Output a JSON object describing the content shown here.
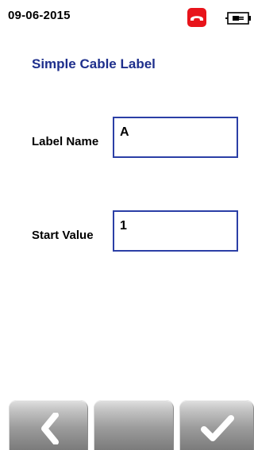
{
  "status": {
    "date": "09-06-2015"
  },
  "icons": {
    "phone": "phone-hangup-icon",
    "battery": "battery-plug-icon",
    "back": "chevron-left-icon",
    "confirm": "checkmark-icon"
  },
  "page": {
    "title": "Simple Cable Label"
  },
  "form": {
    "label_name": {
      "label": "Label Name",
      "value": "A"
    },
    "start_value": {
      "label": "Start Value",
      "value": "1"
    }
  },
  "colors": {
    "title": "#1e2f8c",
    "field_border": "#2b3fa6",
    "phone_icon_bg": "#e8141b"
  }
}
